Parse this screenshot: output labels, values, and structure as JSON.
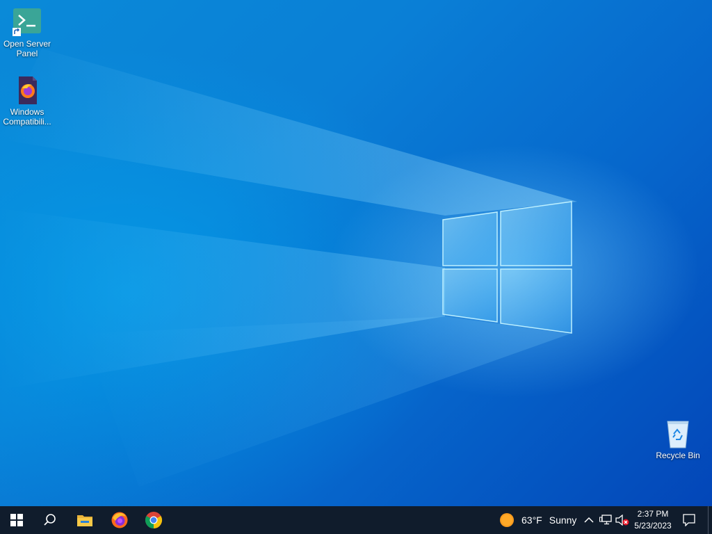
{
  "desktop": {
    "icons": [
      {
        "label": "Open Server\nPanel",
        "icon": "terminal-icon"
      },
      {
        "label": "Windows\nCompatibili...",
        "icon": "firefox-file-icon"
      },
      {
        "label": "Recycle Bin",
        "icon": "recycle-bin-icon"
      }
    ]
  },
  "taskbar": {
    "start": "windows-start-icon",
    "search": "search-icon",
    "pinned": [
      {
        "name": "file-explorer-icon"
      },
      {
        "name": "firefox-icon"
      },
      {
        "name": "chrome-icon"
      }
    ],
    "weather": {
      "temp": "63°F",
      "condition": "Sunny",
      "icon": "sun-icon"
    },
    "tray": {
      "chevron": "chevron-up-icon",
      "network": "network-icon",
      "volume": "volume-muted-icon"
    },
    "clock": {
      "time": "2:37 PM",
      "date": "5/23/2023"
    },
    "notifications": "notification-icon"
  },
  "colors": {
    "taskbar": "#101c2c",
    "desktop_blue": "#0a7fd6"
  }
}
